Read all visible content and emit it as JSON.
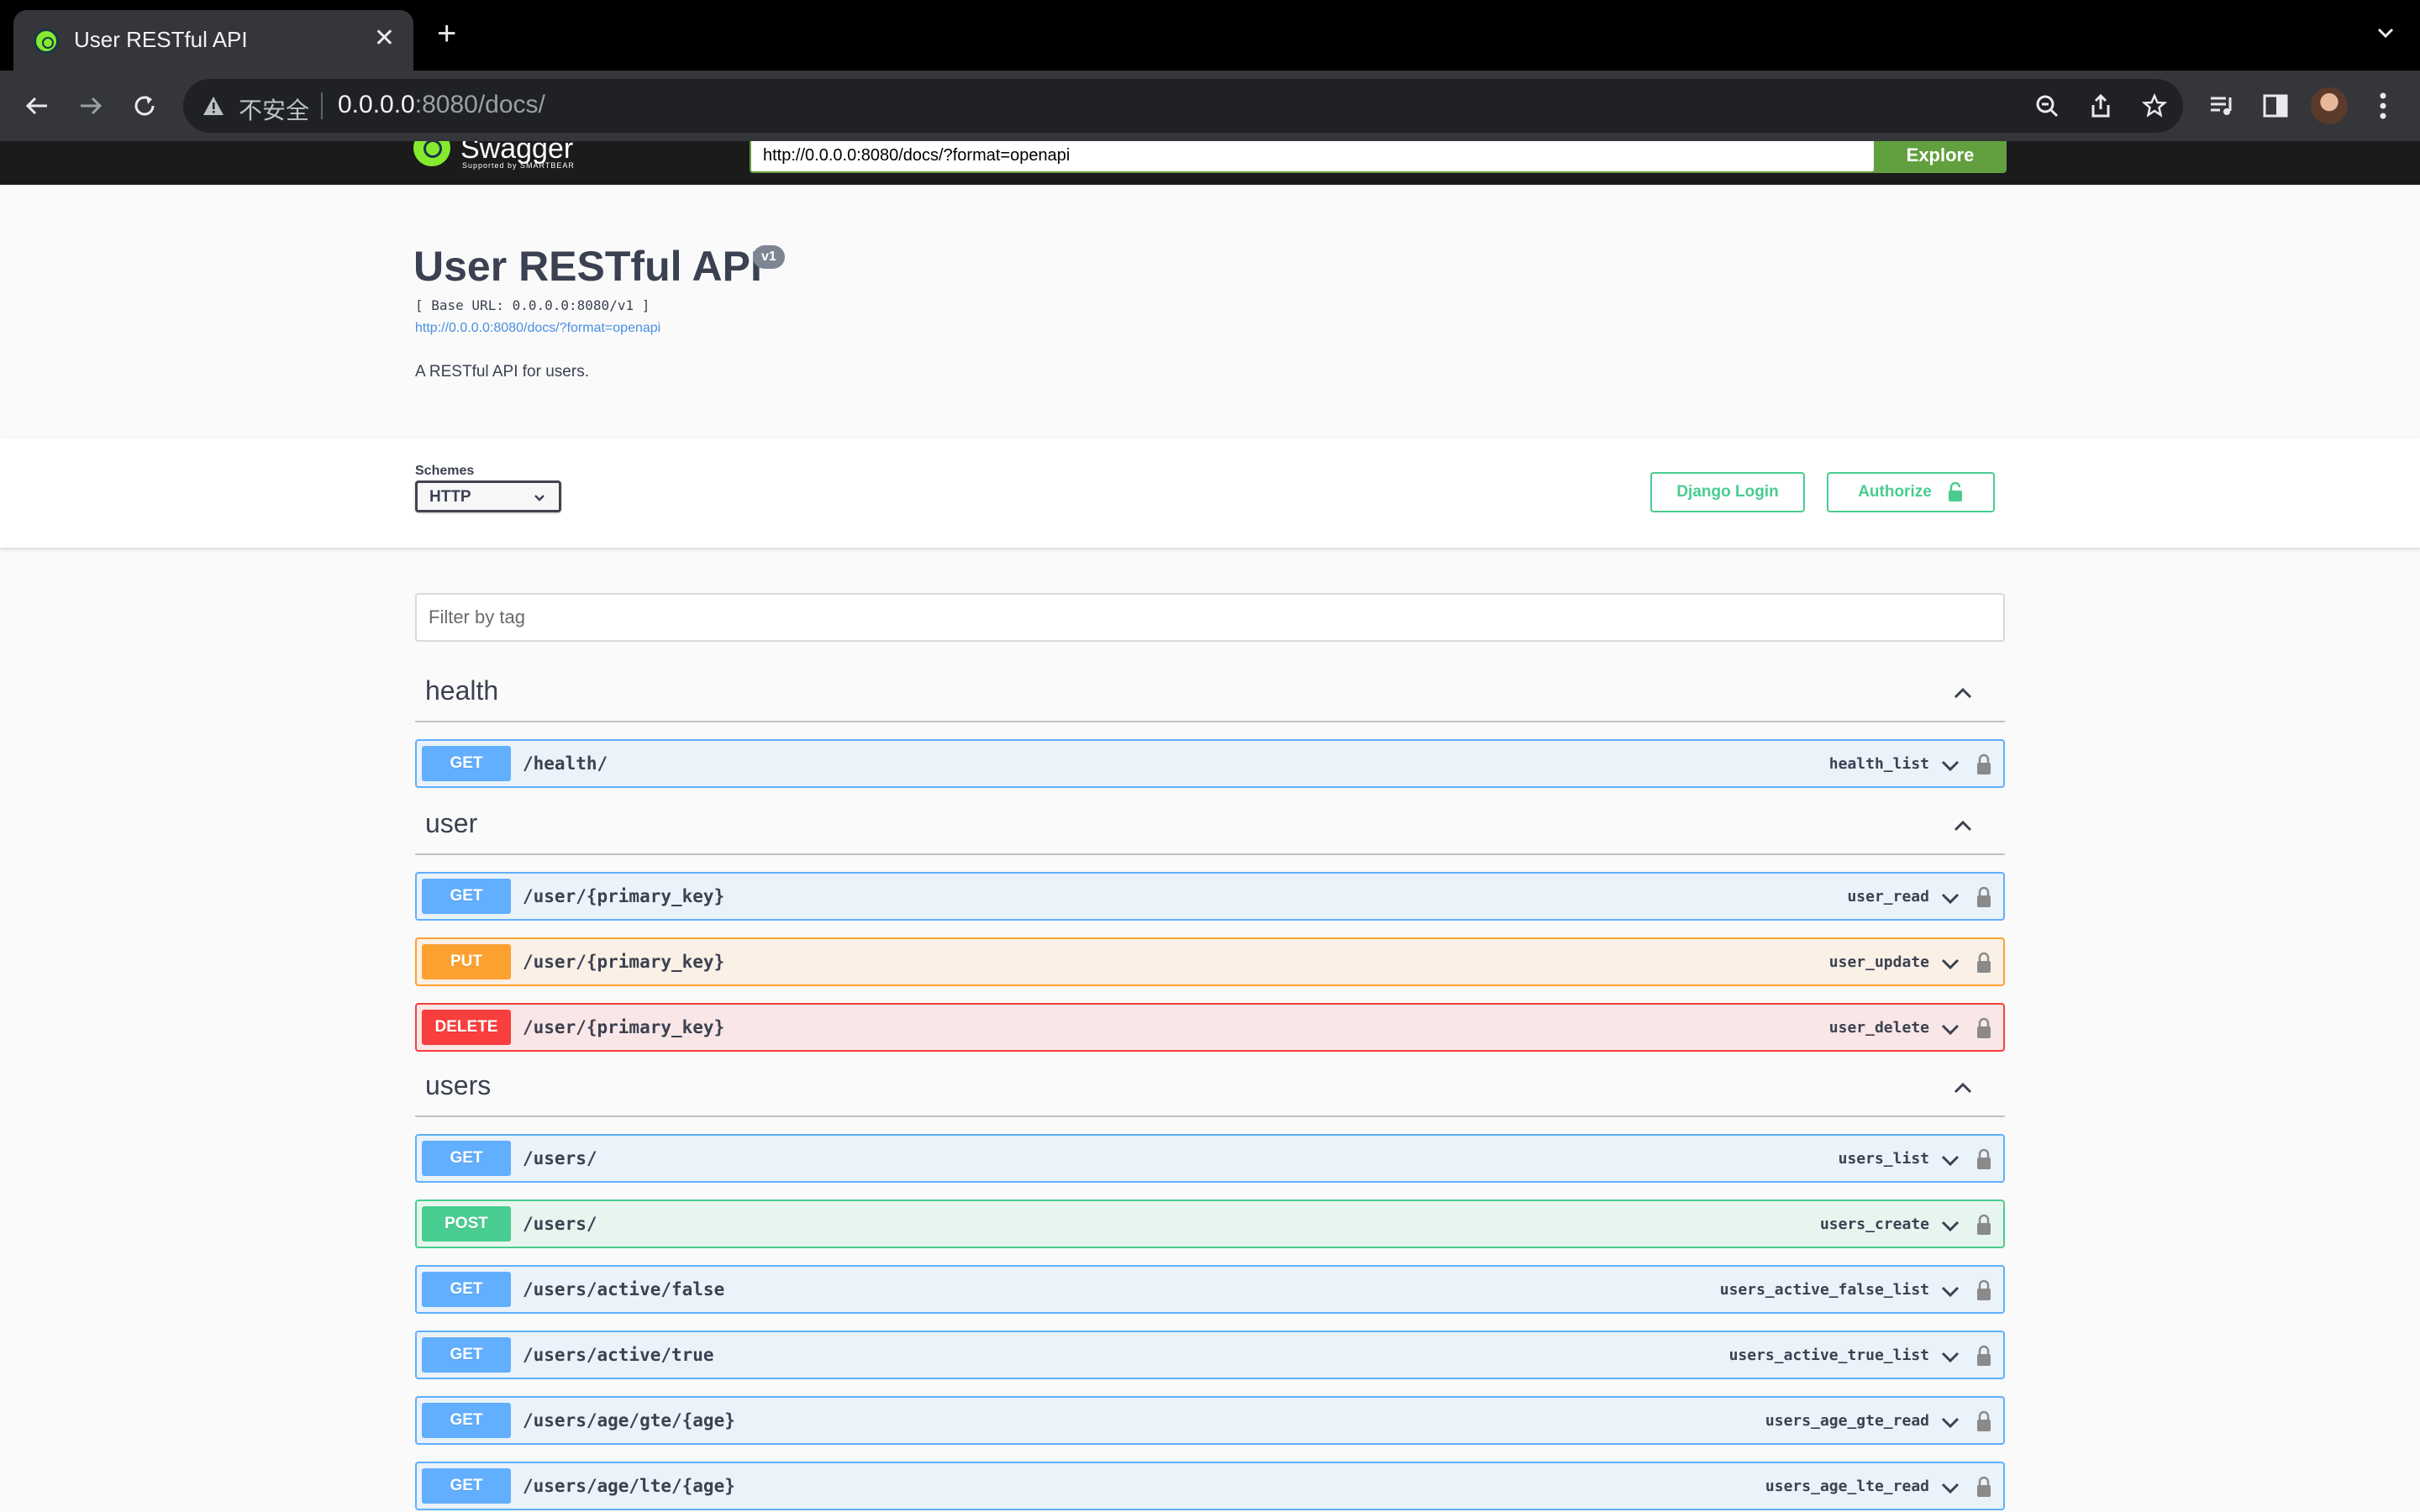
{
  "browser": {
    "tab_title": "User RESTful API",
    "security_label": "不安全",
    "url_host": "0.0.0.0",
    "url_rest": ":8080/docs/"
  },
  "swagger_topbar": {
    "brand": "Swagger",
    "supported_by": "Supported by SMARTBEAR",
    "spec_url": "http://0.0.0.0:8080/docs/?format=openapi",
    "explore_label": "Explore"
  },
  "info": {
    "title": "User RESTful API",
    "version": "v1",
    "base_url": "[ Base URL: 0.0.0.0:8080/v1 ]",
    "spec_link": "http://0.0.0.0:8080/docs/?format=openapi",
    "description": "A RESTful API for users."
  },
  "schemes": {
    "label": "Schemes",
    "selected": "HTTP"
  },
  "buttons": {
    "django_login": "Django Login",
    "authorize": "Authorize"
  },
  "filter": {
    "placeholder": "Filter by tag"
  },
  "tags": [
    {
      "name": "health",
      "operations": [
        {
          "method": "GET",
          "path": "/health/",
          "operation_id": "health_list"
        }
      ]
    },
    {
      "name": "user",
      "operations": [
        {
          "method": "GET",
          "path": "/user/{primary_key}",
          "operation_id": "user_read"
        },
        {
          "method": "PUT",
          "path": "/user/{primary_key}",
          "operation_id": "user_update"
        },
        {
          "method": "DELETE",
          "path": "/user/{primary_key}",
          "operation_id": "user_delete"
        }
      ]
    },
    {
      "name": "users",
      "operations": [
        {
          "method": "GET",
          "path": "/users/",
          "operation_id": "users_list"
        },
        {
          "method": "POST",
          "path": "/users/",
          "operation_id": "users_create"
        },
        {
          "method": "GET",
          "path": "/users/active/false",
          "operation_id": "users_active_false_list"
        },
        {
          "method": "GET",
          "path": "/users/active/true",
          "operation_id": "users_active_true_list"
        },
        {
          "method": "GET",
          "path": "/users/age/gte/{age}",
          "operation_id": "users_age_gte_read"
        },
        {
          "method": "GET",
          "path": "/users/age/lte/{age}",
          "operation_id": "users_age_lte_read"
        }
      ]
    }
  ],
  "colors": {
    "get": "#61affe",
    "put": "#fca130",
    "delete": "#f93e3e",
    "post": "#49cc90",
    "authorize_green": "#49cc90",
    "explore_green": "#62a03f"
  }
}
